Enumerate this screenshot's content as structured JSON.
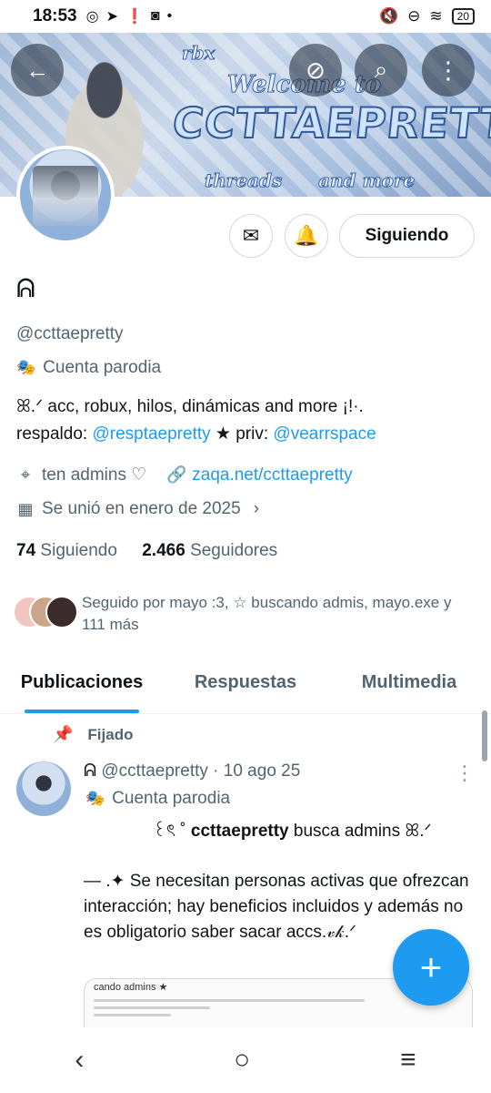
{
  "status_bar": {
    "time": "18:53",
    "battery": "20",
    "network": "4G"
  },
  "banner": {
    "title": "CCTTAEPRETTY",
    "welcome": "Welcome to",
    "threads": "threads",
    "and_more": "and more",
    "rbx": "rbx"
  },
  "profile": {
    "follow_button": "Siguiendo",
    "name_glyph": "ᕱ",
    "handle": "@ccttaepretty",
    "account_type": "Cuenta parodia",
    "bio_line1": "ꕤ.ᐟ acc, robux, hilos, dinámicas and more ¡!·.",
    "bio_respaldo_prefix": "respaldo: ",
    "bio_respaldo_link": "@resptaepretty",
    "bio_priv_prefix": " ★ priv: ",
    "bio_priv_link": "@vearrspace",
    "location": "ten admins ♡",
    "website": "zaqa.net/ccttaepretty",
    "joined": "Se unió en enero de 2025",
    "following_count": "74",
    "following_label": "Siguiendo",
    "followers_count": "2.466",
    "followers_label": "Seguidores",
    "followed_by": "Seguido por mayo :3, ☆ buscando admis, mayo.exe y 111 más"
  },
  "tabs": [
    "Publicaciones",
    "Respuestas",
    "Multimedia"
  ],
  "pinned_post": {
    "pinned_label": "Fijado",
    "author_glyph": "ᕱ",
    "handle_date": "@ccttaepretty · 10 ago 25",
    "account_type": "Cuenta parodia",
    "line1_prefix": "꒰ৎ ˚ ",
    "line1_handle": "ccttaepretty",
    "line1_suffix": " busca admins ꕤ.ᐟ",
    "body": "— .✦ Se necesitan personas activas que ofrezcan interacción; hay beneficios incluidos y además no es obligatorio saber sacar accs.𝓋𝓀.ᐟ",
    "image_title": "cando admins ★"
  },
  "colors": {
    "accent": "#1d9bf0",
    "text": "#0f1419",
    "muted": "#536471"
  }
}
